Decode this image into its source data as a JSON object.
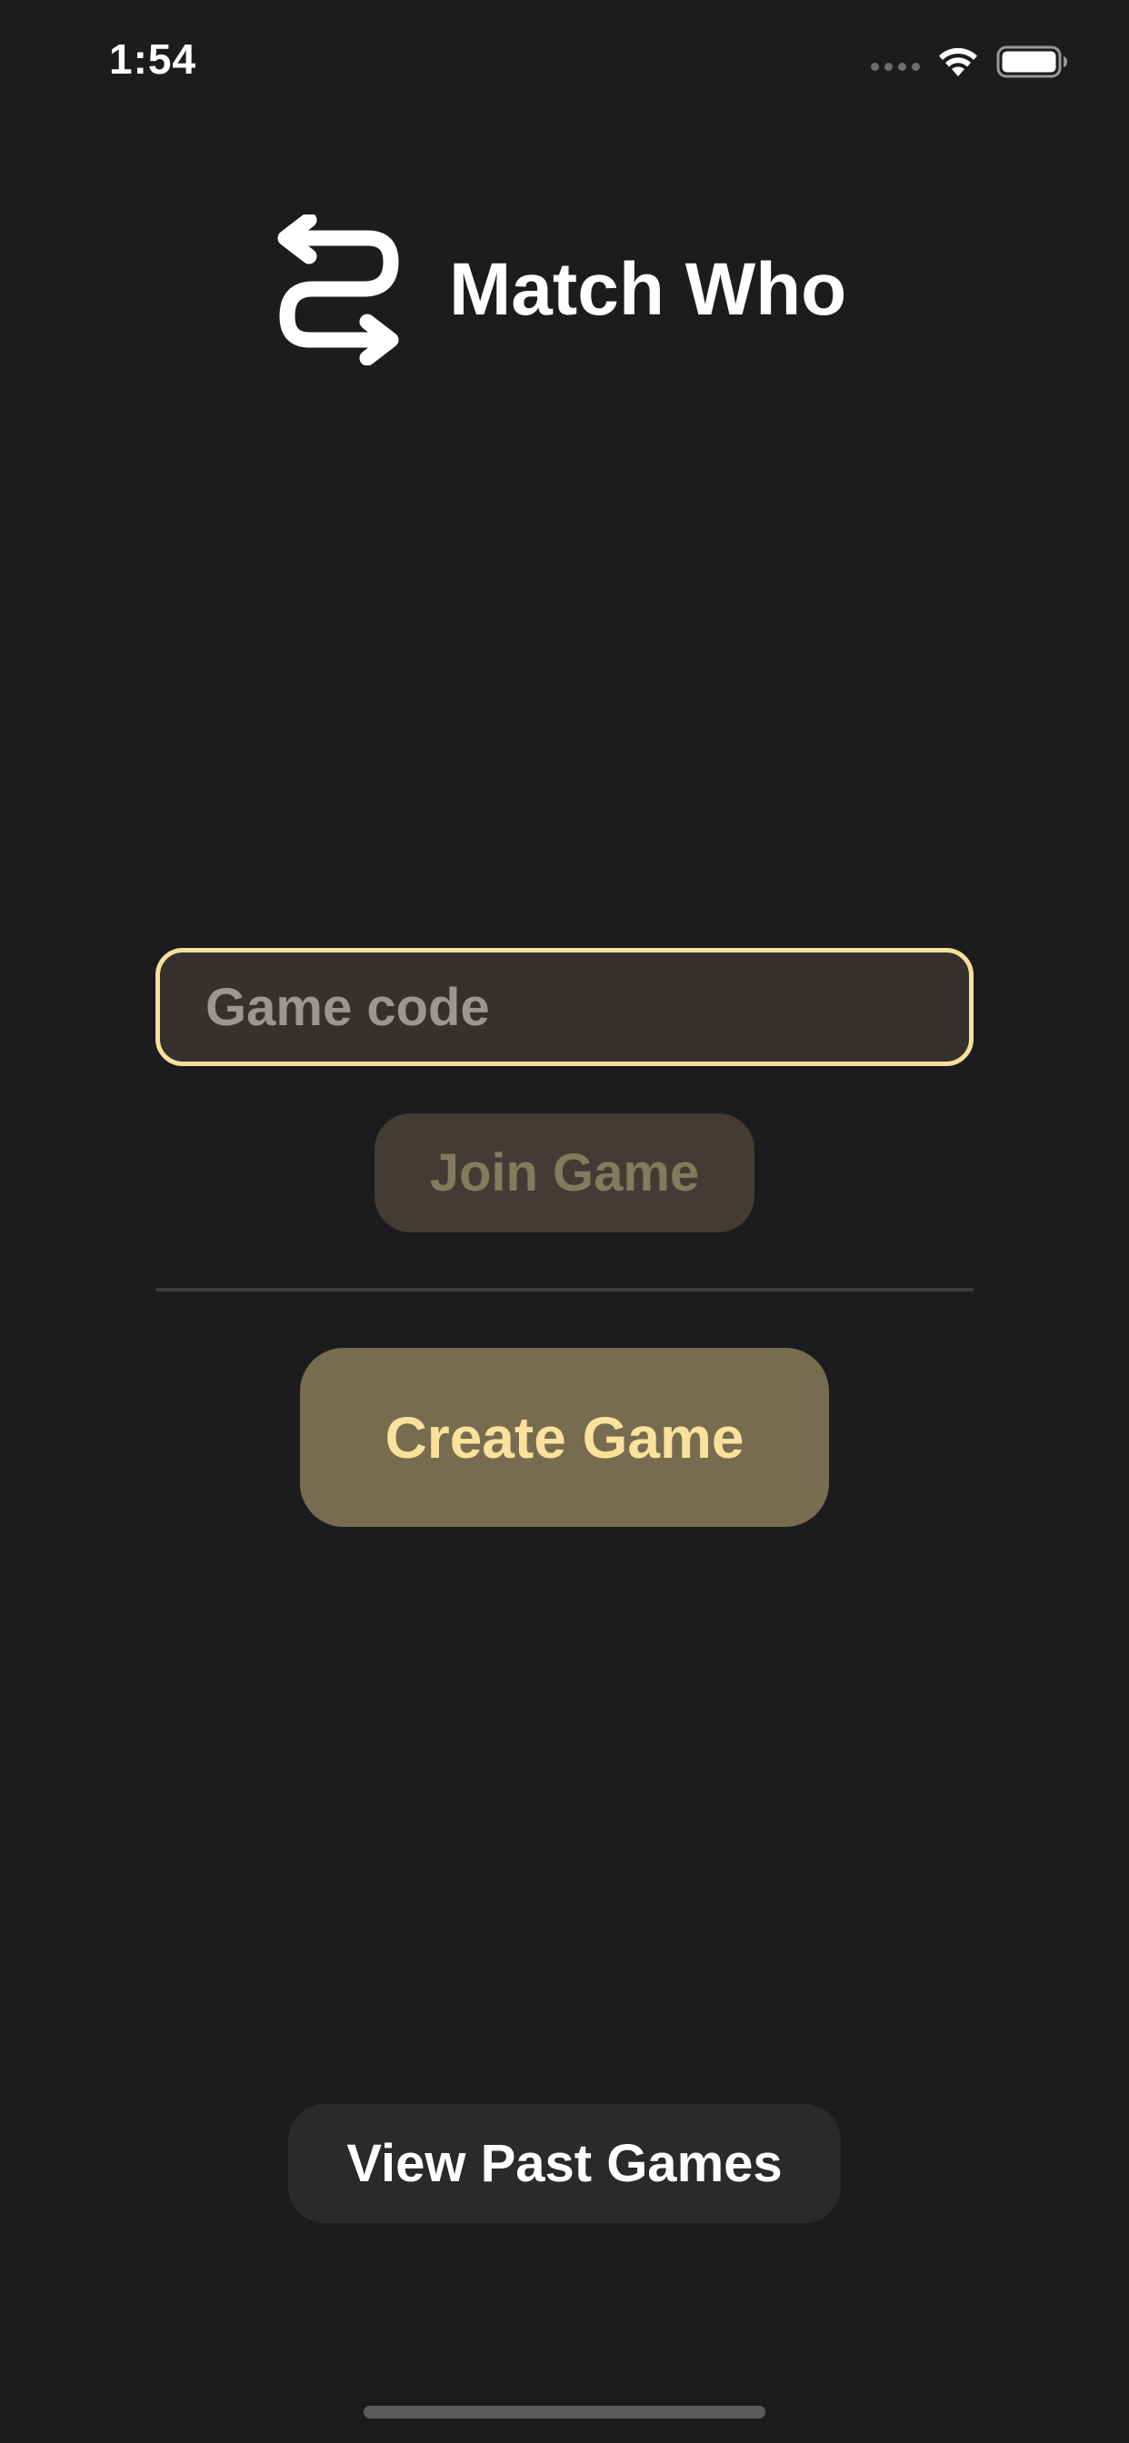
{
  "status_bar": {
    "time": "1:54",
    "icons": [
      "signal-dots-icon",
      "wifi-icon",
      "battery-icon"
    ]
  },
  "header": {
    "logo_icon": "swap-arrows-icon",
    "title": "Match Who"
  },
  "join": {
    "code_placeholder": "Game code",
    "code_value": "",
    "join_label": "Join Game"
  },
  "create": {
    "create_label": "Create Game"
  },
  "footer": {
    "past_games_label": "View Past Games"
  },
  "colors": {
    "background": "#1c1c1e",
    "accent": "#f6e09c",
    "input_fill": "#36312d",
    "join_fill": "#423c34",
    "create_fill": "#776c50",
    "create_text": "#fbe29c",
    "past_fill": "#2a2a2c"
  }
}
